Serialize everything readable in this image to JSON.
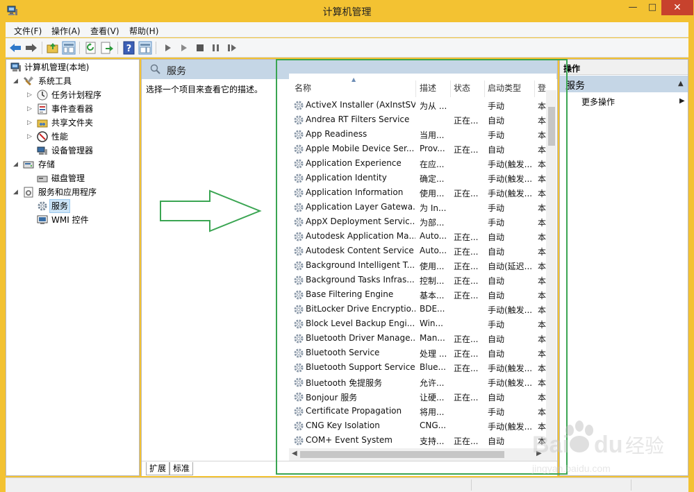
{
  "window": {
    "title": "计算机管理",
    "close_glyph": "✕",
    "max_glyph": "□",
    "min_glyph": "—"
  },
  "menu": [
    "文件(F)",
    "操作(A)",
    "查看(V)",
    "帮助(H)"
  ],
  "toolbar": {
    "icons": [
      "back-icon",
      "forward-icon",
      "up-folder-icon",
      "show-hide-tree-icon",
      "refresh-icon",
      "export-list-icon",
      "help-icon",
      "show-hide-action-pane-icon",
      "play-icon",
      "play-outline-icon",
      "stop-icon",
      "pause-icon",
      "restart-icon"
    ]
  },
  "tree": {
    "root": "计算机管理(本地)",
    "system_tools": "系统工具",
    "task_scheduler": "任务计划程序",
    "event_viewer": "事件查看器",
    "shared_folders": "共享文件夹",
    "performance": "性能",
    "device_manager": "设备管理器",
    "storage": "存储",
    "disk_management": "磁盘管理",
    "services_apps": "服务和应用程序",
    "services": "服务",
    "wmi": "WMI 控件"
  },
  "center": {
    "header": "服务",
    "description_hint": "选择一个项目来查看它的描述。",
    "columns": {
      "name": "名称",
      "desc": "描述",
      "status": "状态",
      "startup": "启动类型",
      "logon": "登"
    },
    "rows": [
      {
        "name": "ActiveX Installer (AxInstSV)",
        "desc": "为从 ...",
        "status": "",
        "startup": "手动",
        "logon": "本"
      },
      {
        "name": "Andrea RT Filters Service",
        "desc": "",
        "status": "正在...",
        "startup": "自动",
        "logon": "本"
      },
      {
        "name": "App Readiness",
        "desc": "当用...",
        "status": "",
        "startup": "手动",
        "logon": "本"
      },
      {
        "name": "Apple Mobile Device Ser...",
        "desc": "Prov...",
        "status": "正在...",
        "startup": "自动",
        "logon": "本"
      },
      {
        "name": "Application Experience",
        "desc": "在应...",
        "status": "",
        "startup": "手动(触发...",
        "logon": "本"
      },
      {
        "name": "Application Identity",
        "desc": "确定...",
        "status": "",
        "startup": "手动(触发...",
        "logon": "本"
      },
      {
        "name": "Application Information",
        "desc": "使用...",
        "status": "正在...",
        "startup": "手动(触发...",
        "logon": "本"
      },
      {
        "name": "Application Layer Gatewa...",
        "desc": "为 In...",
        "status": "",
        "startup": "手动",
        "logon": "本"
      },
      {
        "name": "AppX Deployment Servic...",
        "desc": "为部...",
        "status": "",
        "startup": "手动",
        "logon": "本"
      },
      {
        "name": "Autodesk Application Ma...",
        "desc": "Auto...",
        "status": "正在...",
        "startup": "自动",
        "logon": "本"
      },
      {
        "name": "Autodesk Content Service",
        "desc": "Auto...",
        "status": "正在...",
        "startup": "自动",
        "logon": "本"
      },
      {
        "name": "Background Intelligent T...",
        "desc": "使用...",
        "status": "正在...",
        "startup": "自动(延迟...",
        "logon": "本"
      },
      {
        "name": "Background Tasks Infras...",
        "desc": "控制...",
        "status": "正在...",
        "startup": "自动",
        "logon": "本"
      },
      {
        "name": "Base Filtering Engine",
        "desc": "基本...",
        "status": "正在...",
        "startup": "自动",
        "logon": "本"
      },
      {
        "name": "BitLocker Drive Encryptio...",
        "desc": "BDE...",
        "status": "",
        "startup": "手动(触发...",
        "logon": "本"
      },
      {
        "name": "Block Level Backup Engi...",
        "desc": "Win...",
        "status": "",
        "startup": "手动",
        "logon": "本"
      },
      {
        "name": "Bluetooth Driver Manage...",
        "desc": "Man...",
        "status": "正在...",
        "startup": "自动",
        "logon": "本"
      },
      {
        "name": "Bluetooth Service",
        "desc": "处理 ...",
        "status": "正在...",
        "startup": "自动",
        "logon": "本"
      },
      {
        "name": "Bluetooth Support Service",
        "desc": "Blue...",
        "status": "正在...",
        "startup": "手动(触发...",
        "logon": "本"
      },
      {
        "name": "Bluetooth 免提服务",
        "desc": "允许...",
        "status": "",
        "startup": "手动(触发...",
        "logon": "本"
      },
      {
        "name": "Bonjour 服务",
        "desc": "让硬...",
        "status": "正在...",
        "startup": "自动",
        "logon": "本"
      },
      {
        "name": "Certificate Propagation",
        "desc": "将用...",
        "status": "",
        "startup": "手动",
        "logon": "本"
      },
      {
        "name": "CNG Key Isolation",
        "desc": "CNG...",
        "status": "",
        "startup": "手动(触发...",
        "logon": "本"
      },
      {
        "name": "COM+ Event System",
        "desc": "支持...",
        "status": "正在...",
        "startup": "自动",
        "logon": "本"
      }
    ],
    "tabs": [
      "扩展",
      "标准"
    ]
  },
  "actions": {
    "header": "操作",
    "section": "服务",
    "more": "更多操作"
  },
  "watermark": {
    "brand": "Bai",
    "brand2": "du",
    "cn": "经验",
    "url": "jingyan.baidu.com"
  },
  "colors": {
    "frame": "#f3c232",
    "close": "#c7422d",
    "header_blue": "#c5d6e6",
    "annotation_green": "#3aa552"
  }
}
